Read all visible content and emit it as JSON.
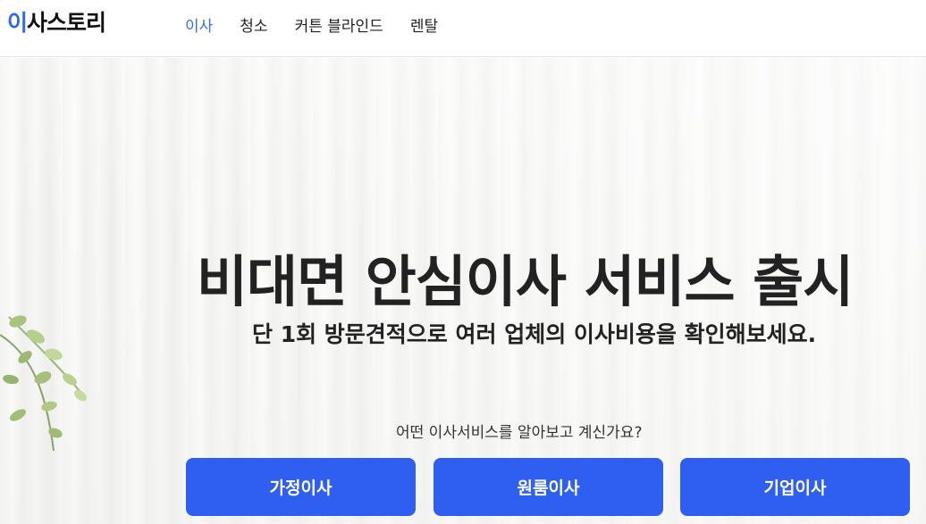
{
  "logo": {
    "accent": "이",
    "rest": "사스토리"
  },
  "nav": {
    "items": [
      {
        "label": "이사",
        "active": true
      },
      {
        "label": "청소",
        "active": false
      },
      {
        "label": "커튼 블라인드",
        "active": false
      },
      {
        "label": "렌탈",
        "active": false
      }
    ]
  },
  "hero": {
    "headline": "비대면 안심이사 서비스 출시",
    "subheadline": "단 1회 방문견적으로 여러 업체의 이사비용을 확인해보세요.",
    "question": "어떤 이사서비스를 알아보고 계신가요?",
    "buttons": [
      {
        "label": "가정이사"
      },
      {
        "label": "원룸이사"
      },
      {
        "label": "기업이사"
      }
    ]
  },
  "colors": {
    "accent": "#2e6ae6",
    "button": "#2f5ff0",
    "nav_active": "#3a6fe0"
  }
}
